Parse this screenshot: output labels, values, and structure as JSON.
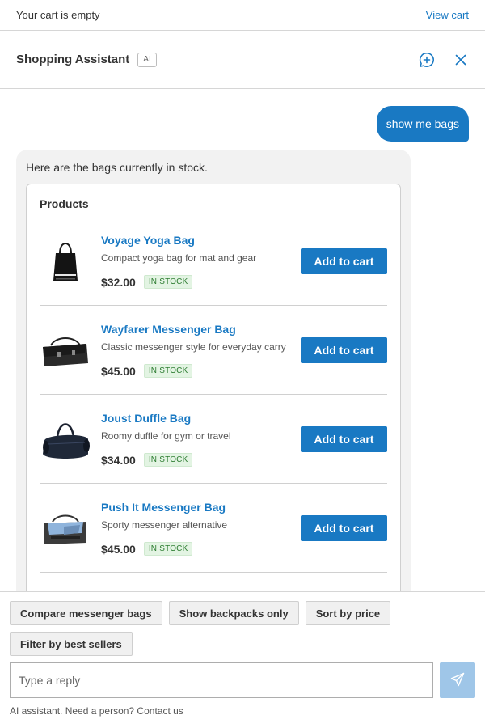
{
  "topbar": {
    "cart_status": "Your cart is empty",
    "view_cart": "View cart"
  },
  "header": {
    "title": "Shopping Assistant",
    "ai_badge": "AI"
  },
  "chat": {
    "user_message": "show me bags",
    "bot_intro": "Here are the bags currently in stock.",
    "products_title": "Products",
    "products": [
      {
        "name": "Voyage Yoga Bag",
        "description": "Compact yoga bag for mat and gear",
        "price": "$32.00",
        "stock": "IN STOCK",
        "button": "Add to cart",
        "image": "yoga-tote-bag"
      },
      {
        "name": "Wayfarer Messenger Bag",
        "description": "Classic messenger style for everyday carry",
        "price": "$45.00",
        "stock": "IN STOCK",
        "button": "Add to cart",
        "image": "black-messenger-bag"
      },
      {
        "name": "Joust Duffle Bag",
        "description": "Roomy duffle for gym or travel",
        "price": "$34.00",
        "stock": "IN STOCK",
        "button": "Add to cart",
        "image": "navy-duffle-bag"
      },
      {
        "name": "Push It Messenger Bag",
        "description": "Sporty messenger alternative",
        "price": "$45.00",
        "stock": "IN STOCK",
        "button": "Add to cart",
        "image": "grey-blue-messenger-bag"
      }
    ]
  },
  "suggestions": [
    "Compare messenger bags",
    "Show backpacks only",
    "Sort by price",
    "Filter by best sellers"
  ],
  "composer": {
    "placeholder": "Type a reply",
    "footnote": "AI assistant. Need a person? Contact us"
  },
  "colors": {
    "accent": "#1979c3",
    "send_disabled": "#9fc6e8",
    "stock_green": "#2e7d32"
  }
}
